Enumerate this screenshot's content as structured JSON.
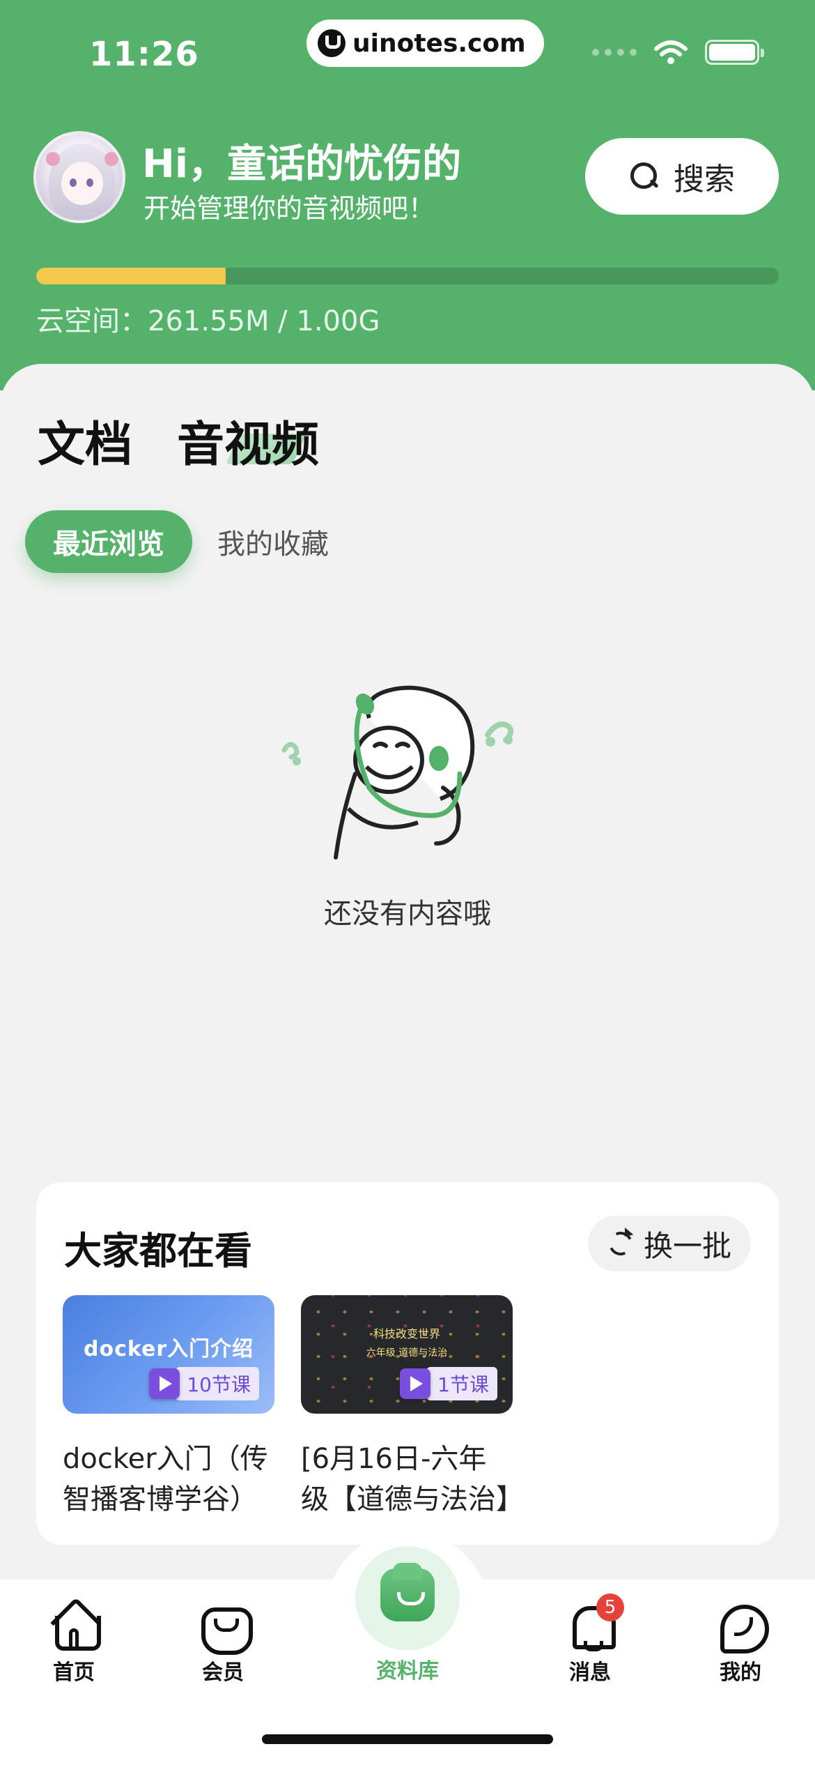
{
  "status_bar": {
    "time": "11:26",
    "url": "uinotes.com"
  },
  "header": {
    "greeting": "Hi，童话的忧伤的",
    "subgreeting": "开始管理你的音视频吧！",
    "search_label": "搜索",
    "storage": {
      "text": "云空间：261.55M / 1.00G",
      "used_fraction": 0.255
    },
    "colors": {
      "brand_green": "#55b26a",
      "progress": "#f2c94c"
    }
  },
  "main_tabs": [
    {
      "label": "文档"
    },
    {
      "label": "音视频",
      "active": true
    }
  ],
  "sub_tabs": [
    {
      "label": "最近浏览",
      "active": true
    },
    {
      "label": "我的收藏"
    }
  ],
  "empty_state": {
    "text": "还没有内容哦",
    "icon": "lion-headphones-illustration"
  },
  "popular": {
    "title": "大家都在看",
    "refresh_label": "换一批",
    "courses": [
      {
        "thumb_title": "docker入门介绍",
        "badge": "10节课",
        "name": "docker入门（传智播客博学谷）"
      },
      {
        "thumb_line1": "科技改变世界",
        "thumb_line2": "六年级  道德与法治",
        "badge": "1节课",
        "name": "[6月16日-六年级【道德与法治】"
      }
    ]
  },
  "tabbar": {
    "items": [
      {
        "label": "首页",
        "icon": "home-icon"
      },
      {
        "label": "会员",
        "icon": "vip-icon"
      },
      {
        "label": "资料库",
        "icon": "library-icon",
        "active": true
      },
      {
        "label": "消息",
        "icon": "bell-icon",
        "badge": "5"
      },
      {
        "label": "我的",
        "icon": "profile-icon"
      }
    ]
  }
}
